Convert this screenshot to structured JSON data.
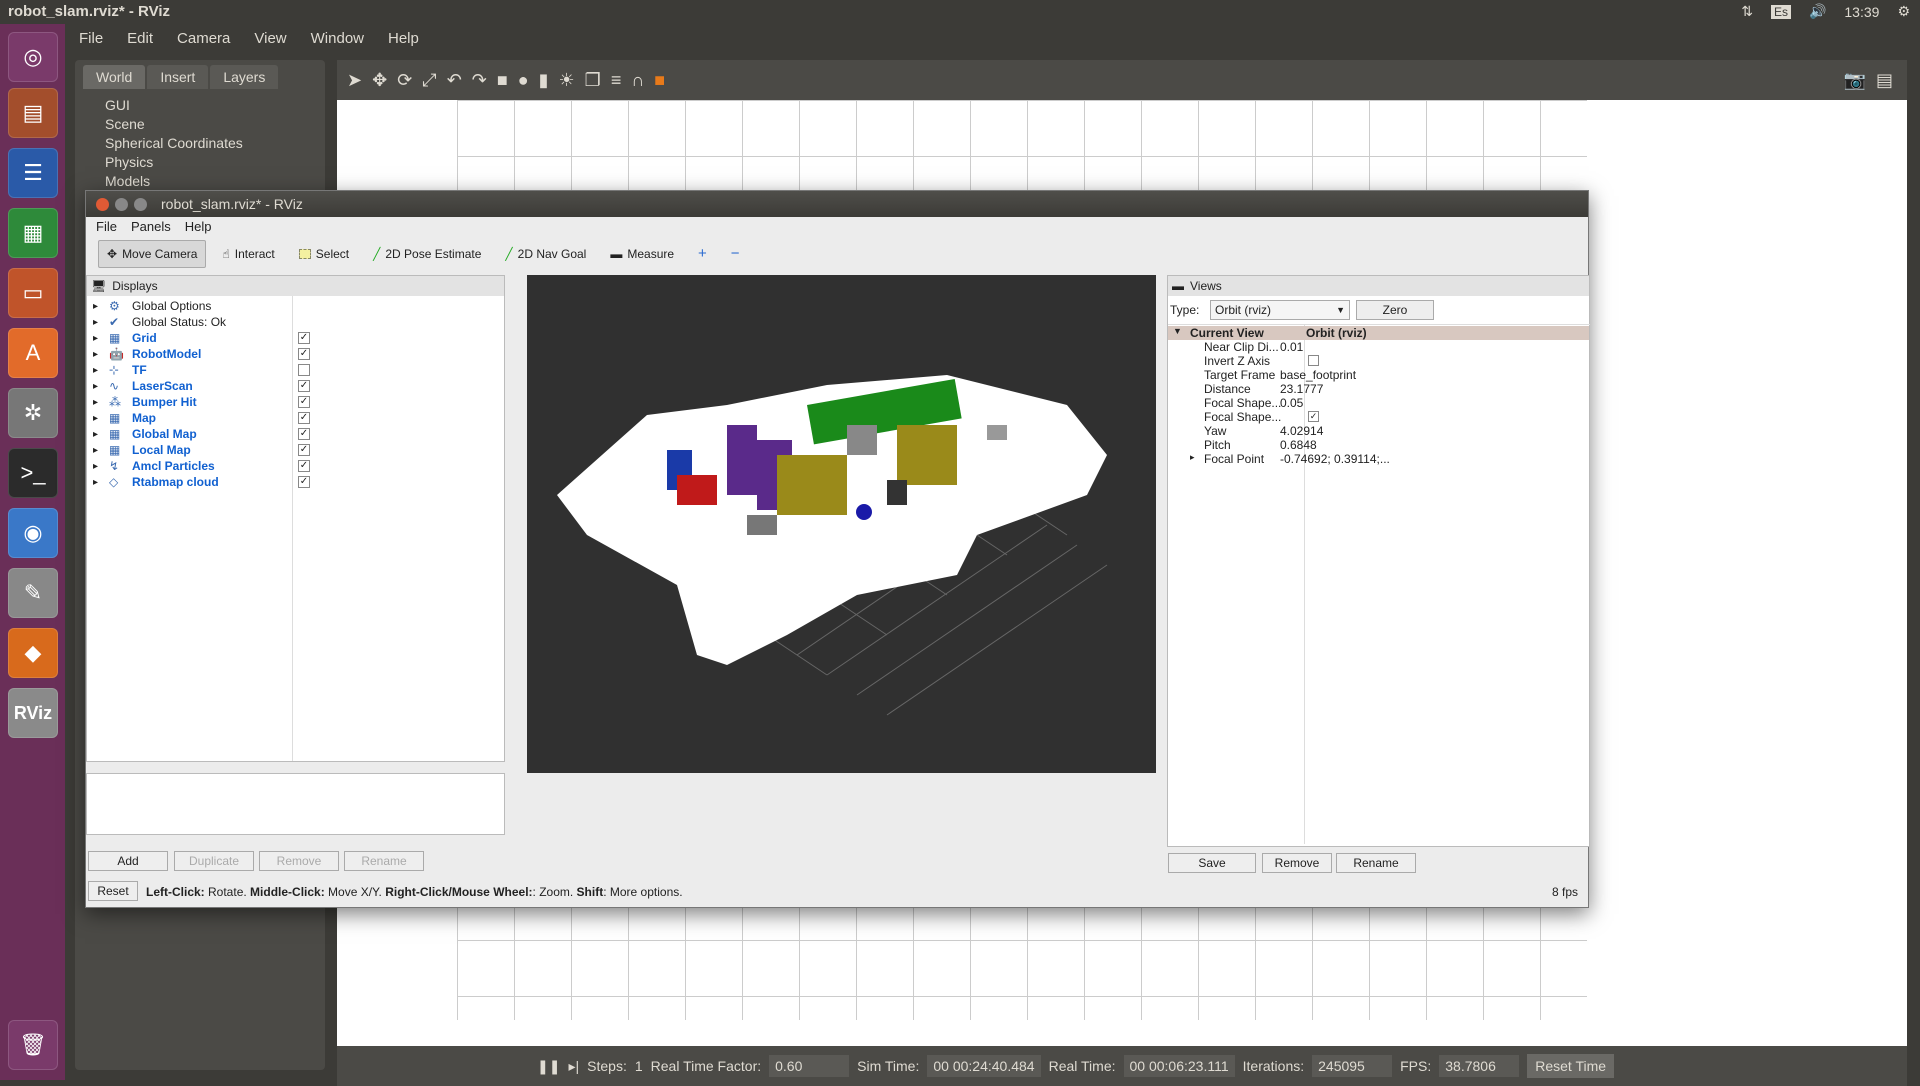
{
  "topbar": {
    "title": "robot_slam.rviz* - RViz",
    "lang": "Es",
    "time": "13:39"
  },
  "launcher": [
    "ubuntu-icon",
    "files-icon",
    "writer-icon",
    "calc-icon",
    "impress-icon",
    "software-icon",
    "settings-icon",
    "terminal-icon",
    "chromium-icon",
    "editor-icon",
    "sublime-icon",
    "rviz-icon"
  ],
  "launcher_rviz_label": "RViz",
  "gazebo": {
    "menu": [
      "File",
      "Edit",
      "Camera",
      "View",
      "Window",
      "Help"
    ],
    "tabs": [
      "World",
      "Insert",
      "Layers"
    ],
    "tree": [
      "GUI",
      "Scene",
      "Spherical Coordinates",
      "Physics",
      "Models"
    ],
    "status": {
      "steps_label": "Steps:",
      "steps": "1",
      "rtf_label": "Real Time Factor:",
      "rtf": "0.60",
      "sim_label": "Sim Time:",
      "sim": "00 00:24:40.484",
      "real_label": "Real Time:",
      "real": "00 00:06:23.111",
      "iter_label": "Iterations:",
      "iter": "245095",
      "fps_label": "FPS:",
      "fps": "38.7806",
      "reset": "Reset Time"
    }
  },
  "rviz": {
    "title": "robot_slam.rviz* - RViz",
    "menu": [
      "File",
      "Panels",
      "Help"
    ],
    "tools": [
      "Move Camera",
      "Interact",
      "Select",
      "2D Pose Estimate",
      "2D Nav Goal",
      "Measure"
    ],
    "displays_title": "Displays",
    "displays": [
      {
        "label": "Global Options",
        "checked": null
      },
      {
        "label": "Global Status: Ok",
        "checked": null
      },
      {
        "label": "Grid",
        "checked": true
      },
      {
        "label": "RobotModel",
        "checked": true
      },
      {
        "label": "TF",
        "checked": false
      },
      {
        "label": "LaserScan",
        "checked": true
      },
      {
        "label": "Bumper Hit",
        "checked": true
      },
      {
        "label": "Map",
        "checked": true
      },
      {
        "label": "Global Map",
        "checked": true
      },
      {
        "label": "Local Map",
        "checked": true
      },
      {
        "label": "Amcl Particles",
        "checked": true
      },
      {
        "label": "Rtabmap cloud",
        "checked": true
      }
    ],
    "display_buttons": [
      "Add",
      "Duplicate",
      "Remove",
      "Rename"
    ],
    "views_title": "Views",
    "type_label": "Type:",
    "type_value": "Orbit (rviz)",
    "zero": "Zero",
    "current_view": {
      "k": "Current View",
      "v": "Orbit (rviz)"
    },
    "view_props": [
      {
        "k": "Near Clip Di...",
        "v": "0.01"
      },
      {
        "k": "Invert Z Axis",
        "v": ""
      },
      {
        "k": "Target Frame",
        "v": "base_footprint"
      },
      {
        "k": "Distance",
        "v": "23.1777"
      },
      {
        "k": "Focal Shape...",
        "v": "0.05"
      },
      {
        "k": "Focal Shape...",
        "v": ""
      },
      {
        "k": "Yaw",
        "v": "4.02914"
      },
      {
        "k": "Pitch",
        "v": "0.6848"
      },
      {
        "k": "Focal Point",
        "v": "-0.74692; 0.39114;..."
      }
    ],
    "view_buttons": [
      "Save",
      "Remove",
      "Rename"
    ],
    "reset": "Reset",
    "help_bold1": "Left-Click:",
    "help1": " Rotate. ",
    "help_bold2": "Middle-Click:",
    "help2": " Move X/Y. ",
    "help_bold3": "Right-Click/Mouse Wheel:",
    "help3": ": Zoom. ",
    "help_bold4": "Shift",
    "help4": ": More options.",
    "fps": "8 fps"
  }
}
